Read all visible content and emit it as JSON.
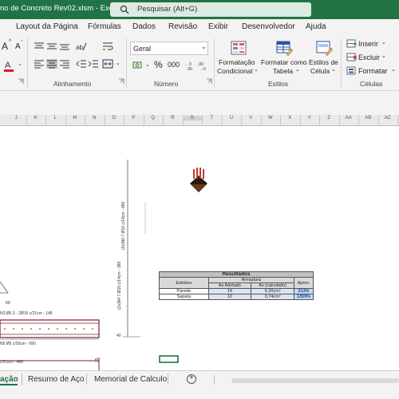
{
  "titlebar": {
    "file_title": "no de Concreto Rev02.xlsm  -  Excel",
    "search_placeholder": "Pesquisar (Alt+G)"
  },
  "menu": {
    "tabs": [
      "Layout da Página",
      "Fórmulas",
      "Dados",
      "Revisão",
      "Exibir",
      "Desenvolvedor",
      "Ajuda"
    ]
  },
  "ribbon": {
    "font_size_a_up": "A",
    "font_size_a_down": "A",
    "number_format": "Geral",
    "percent": "%",
    "thousands": "000",
    "group_alignment": "Alinhamento",
    "group_number": "Número",
    "group_styles": "Estilos",
    "group_cells": "Células",
    "conditional_format_l1": "Formatação",
    "conditional_format_l2": "Condicional",
    "format_table_l1": "Formatar como",
    "format_table_l2": "Tabela",
    "cell_styles_l1": "Estilos de",
    "cell_styles_l2": "Célula",
    "insert": "Inserir",
    "delete": "Excluir",
    "format": "Formatar"
  },
  "columns": [
    "J",
    "K",
    "L",
    "M",
    "N",
    "O",
    "P",
    "Q",
    "R",
    "S",
    "T",
    "U",
    "V",
    "W",
    "X",
    "Y",
    "Z",
    "AA",
    "AB",
    "AC"
  ],
  "sheet": {
    "dim_60": "60",
    "dim_40": "40",
    "rebar_label_1": "N3 Ø6.3 - 2Ø16 c/21cm - 148",
    "rebar_label_2": "N5 Ø5 c/20cm - 990",
    "rebar_label_3": "c/21cm - 460",
    "vertical_label_1": "(2x)N4 7 Ø16 c/14cm - 385",
    "vertical_label_2": "(2x)N6 7 Ø16 c/14cm - 990",
    "side_35": "35"
  },
  "results": {
    "title": "Resultados",
    "col_estribos": "Estribos",
    "col_armadura": "Armadura",
    "col_adotado": "As Adotado",
    "col_calculado": "As (calculado)",
    "col_aprov": "Aprov.",
    "rows": [
      {
        "name": "Parede",
        "adotado": "14",
        "calculado": "6,30cm²",
        "aprov": "213%"
      },
      {
        "name": "Sapata",
        "adotado": "10",
        "calculado": "0,74cm²",
        "aprov": "1359%"
      }
    ]
  },
  "sheet_tabs": {
    "active": "ação",
    "tab2": "Resumo de Aço",
    "tab3": "Memorial de Calculo",
    "add": "+"
  }
}
